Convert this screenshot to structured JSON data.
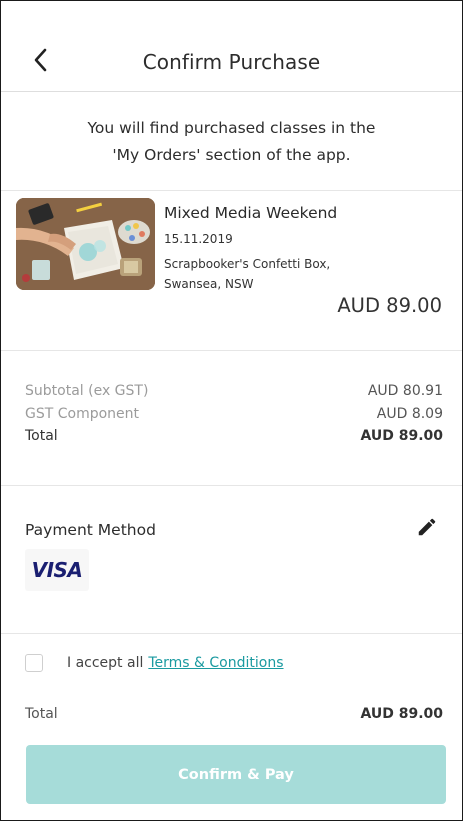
{
  "header": {
    "title": "Confirm Purchase",
    "back_icon": "chevron-left-icon"
  },
  "info": {
    "line1": "You will find purchased classes in the",
    "line2": "'My Orders' section of the app."
  },
  "item": {
    "title": "Mixed Media Weekend",
    "date": "15.11.2019",
    "venue_line1": "Scrapbooker's Confetti Box,",
    "venue_line2": "Swansea, NSW",
    "price": "AUD 89.00",
    "image_icon": "class-photo-thumbnail"
  },
  "summary": {
    "subtotal_label": "Subtotal (ex GST)",
    "subtotal_value": "AUD 80.91",
    "gst_label": "GST Component",
    "gst_value": "AUD 8.09",
    "total_label": "Total",
    "total_value": "AUD 89.00"
  },
  "payment": {
    "label": "Payment Method",
    "card_brand": "VISA",
    "edit_icon": "pencil-icon"
  },
  "terms": {
    "checked": false,
    "text": "I accept all",
    "link": "Terms & Conditions"
  },
  "footer": {
    "total_label": "Total",
    "total_value": "AUD 89.00",
    "confirm_label": "Confirm & Pay"
  },
  "colors": {
    "accent": "#1a9aa0",
    "confirm_button_disabled": "#a6dcd9",
    "visa_blue": "#1a1f71"
  }
}
